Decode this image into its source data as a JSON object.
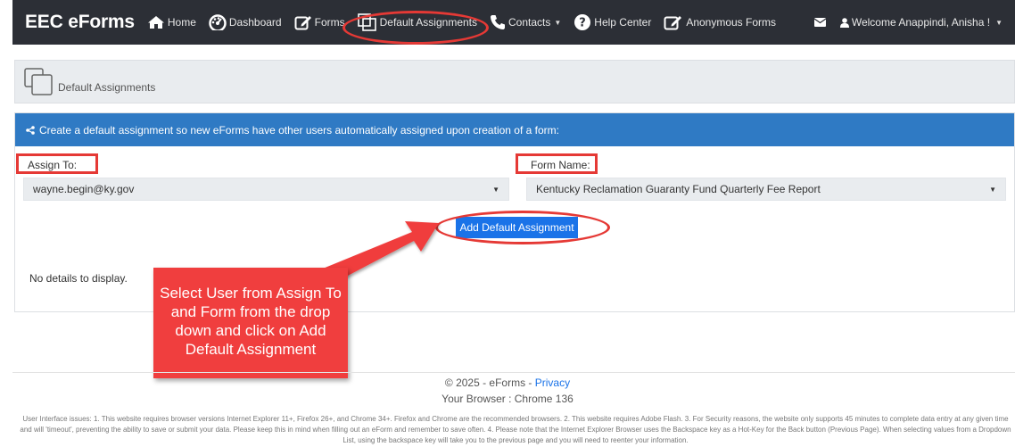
{
  "navbar": {
    "brand": "EEC eForms",
    "items": [
      {
        "label": "Home",
        "icon": "home-icon"
      },
      {
        "label": "Dashboard",
        "icon": "dashboard-icon"
      },
      {
        "label": "Forms",
        "icon": "edit-icon"
      },
      {
        "label": "Default Assignments",
        "icon": "clone-icon"
      },
      {
        "label": "Contacts",
        "icon": "phone-icon",
        "dropdown": true
      },
      {
        "label": "Help Center",
        "icon": "question-circle-icon"
      },
      {
        "label": "Anonymous Forms",
        "icon": "edit-icon"
      }
    ],
    "welcome": "Welcome Anappindi, Anisha !"
  },
  "breadcrumb": {
    "title": "Default Assignments"
  },
  "card": {
    "header": "Create a default assignment so new eForms have other users automatically assigned upon creation of a form:",
    "assign_to_label": "Assign To:",
    "assign_to_value": "wayne.begin@ky.gov",
    "form_name_label": "Form Name:",
    "form_name_value": "Kentucky Reclamation Guaranty Fund Quarterly Fee Report",
    "button_label": "Add Default Assignment",
    "empty_message": "No details to display."
  },
  "callout": {
    "text": "Select User from Assign To and Form from the drop down and click on Add Default Assignment"
  },
  "footer": {
    "copyright": "© 2025 - eForms - ",
    "privacy_link": "Privacy",
    "browser": "Your Browser : Chrome 136",
    "notice": "User Interface issues: 1. This website requires browser versions Internet Explorer 11+, Firefox 26+, and Chrome 34+. Firefox and Chrome are the recommended browsers. 2. This website requires Adobe Flash. 3. For Security reasons, the website only supports 45 minutes to complete data entry at any given time and will 'timeout', preventing the ability to save or submit your data. Please keep this in mind when filling out an eForm and remember to save often. 4. Please note that the Internet Explorer Browser uses the Backspace key as a Hot-Key for the Back button (Previous Page). When selecting values from a Dropdown List, using the backspace key will take you to the previous page and you will need to reenter your information."
  },
  "colors": {
    "navbar": "#2c2f36",
    "header_blue": "#2f7ac4",
    "button_blue": "#1a73e8",
    "annotation_red": "#e53935",
    "callout_red": "#f03e3e"
  }
}
